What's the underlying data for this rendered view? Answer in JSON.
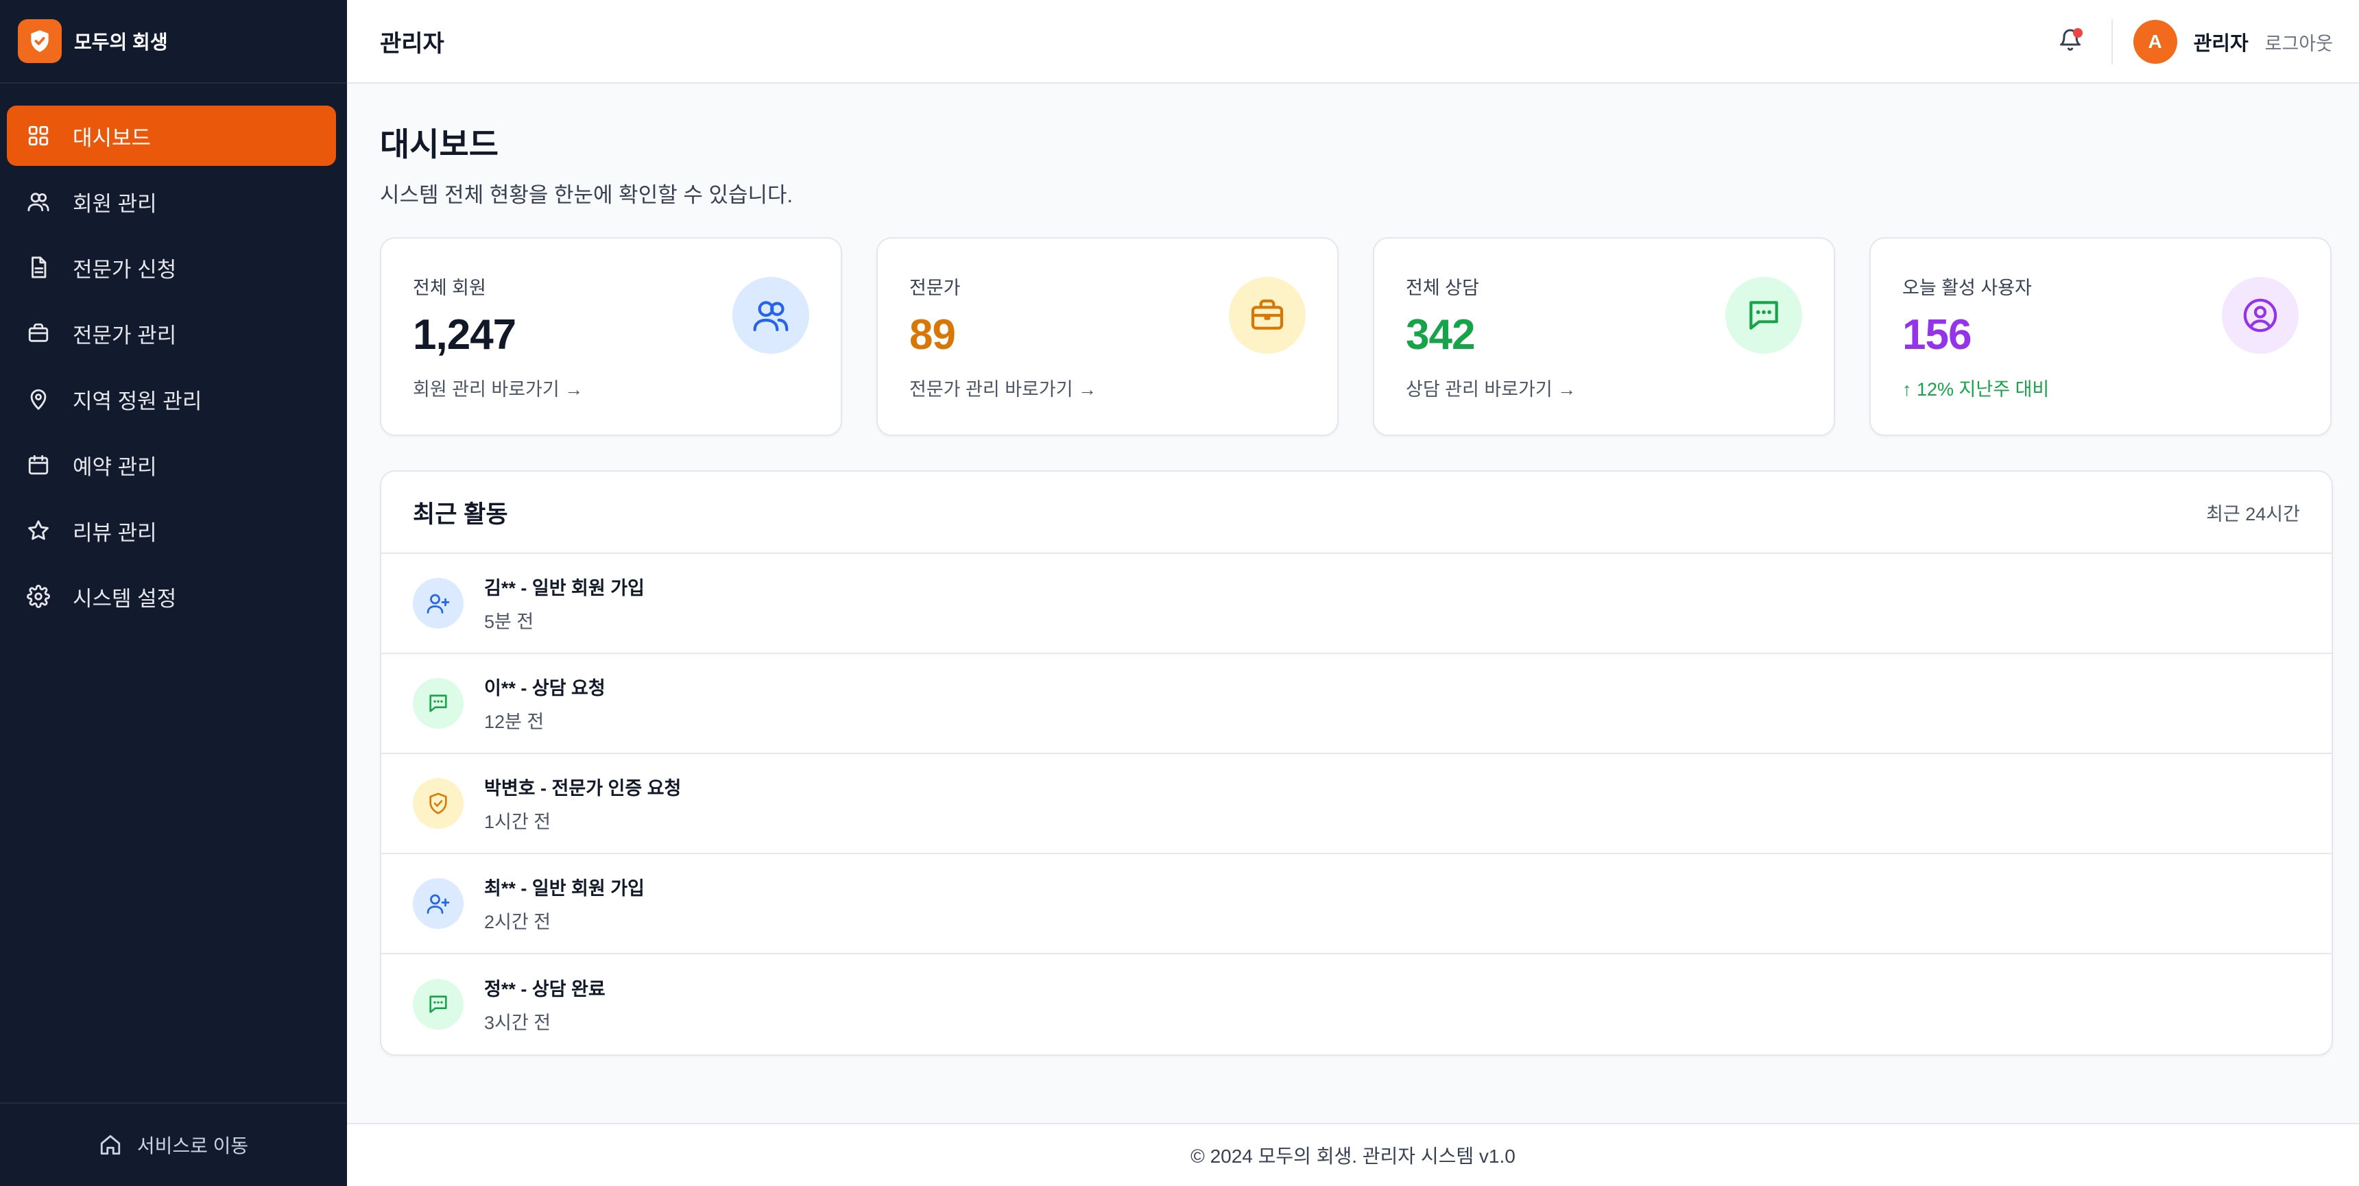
{
  "brand": {
    "name": "모두의 회생",
    "color": "#f26b1d"
  },
  "sidebar": {
    "items": [
      {
        "label": "대시보드",
        "icon": "grid-icon",
        "active": true
      },
      {
        "label": "회원 관리",
        "icon": "users-icon"
      },
      {
        "label": "전문가 신청",
        "icon": "document-icon"
      },
      {
        "label": "전문가 관리",
        "icon": "briefcase-icon"
      },
      {
        "label": "지역 정원 관리",
        "icon": "map-pin-icon"
      },
      {
        "label": "예약 관리",
        "icon": "calendar-icon"
      },
      {
        "label": "리뷰 관리",
        "icon": "star-icon"
      },
      {
        "label": "시스템 설정",
        "icon": "gear-icon"
      }
    ],
    "footer_label": "서비스로 이동"
  },
  "header": {
    "title": "관리자",
    "avatar_letter": "A",
    "user_name": "관리자",
    "logout_label": "로그아웃"
  },
  "page": {
    "title": "대시보드",
    "subtitle": "시스템 전체 현황을 한눈에 확인할 수 있습니다."
  },
  "stats": [
    {
      "label": "전체 회원",
      "value": "1,247",
      "link": "회원 관리 바로가기 →",
      "color": "#111827",
      "icon_bg": "#dbeafe",
      "icon_color": "#2563eb",
      "icon": "users-icon"
    },
    {
      "label": "전문가",
      "value": "89",
      "link": "전문가 관리 바로가기 →",
      "color": "#d97706",
      "icon_bg": "#fef3c7",
      "icon_color": "#d97706",
      "icon": "briefcase-icon"
    },
    {
      "label": "전체 상담",
      "value": "342",
      "link": "상담 관리 바로가기 →",
      "color": "#16a34a",
      "icon_bg": "#dcfce7",
      "icon_color": "#16a34a",
      "icon": "chat-icon"
    },
    {
      "label": "오늘 활성 사용자",
      "value": "156",
      "trend": "↑ 12% 지난주 대비",
      "color": "#9333ea",
      "icon_bg": "#f3e8ff",
      "icon_color": "#9333ea",
      "icon": "user-circle-icon"
    }
  ],
  "activity": {
    "title": "최근 활동",
    "range": "최근 24시간",
    "items": [
      {
        "title": "김** - 일반 회원 가입",
        "time": "5분 전",
        "icon": "user-plus-icon",
        "icon_bg": "#dbeafe",
        "icon_color": "#2563eb"
      },
      {
        "title": "이** - 상담 요청",
        "time": "12분 전",
        "icon": "chat-icon",
        "icon_bg": "#dcfce7",
        "icon_color": "#16a34a"
      },
      {
        "title": "박변호 - 전문가 인증 요청",
        "time": "1시간 전",
        "icon": "shield-check-icon",
        "icon_bg": "#fef3c7",
        "icon_color": "#d97706"
      },
      {
        "title": "최** - 일반 회원 가입",
        "time": "2시간 전",
        "icon": "user-plus-icon",
        "icon_bg": "#dbeafe",
        "icon_color": "#2563eb"
      },
      {
        "title": "정** - 상담 완료",
        "time": "3시간 전",
        "icon": "chat-icon",
        "icon_bg": "#dcfce7",
        "icon_color": "#16a34a"
      }
    ]
  },
  "footer": {
    "text": "© 2024 모두의 회생. 관리자 시스템 v1.0"
  }
}
